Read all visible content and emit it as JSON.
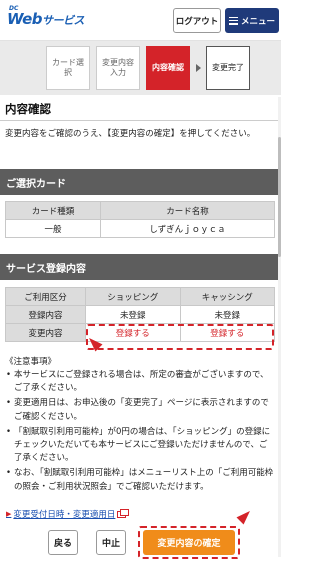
{
  "header": {
    "logo_sub": "DC",
    "logo_main": "Web",
    "logo_suffix": "サービス",
    "logout_label": "ログアウト",
    "menu_label": "メニュー"
  },
  "steps": [
    {
      "label": "カード選択"
    },
    {
      "label": "変更内容入力"
    },
    {
      "label": "内容確認"
    },
    {
      "label": "変更完了"
    }
  ],
  "page": {
    "title": "内容確認",
    "intro": "変更内容をご確認のうえ、【変更内容の確定】を押してください。"
  },
  "card_section": {
    "heading": "ご選択カード",
    "columns": [
      "カード種類",
      "カード名称"
    ],
    "row": [
      "一般",
      "しずぎんｊｏｙｃａ"
    ]
  },
  "service_section": {
    "heading": "サービス登録内容",
    "columns": [
      "ご利用区分",
      "ショッピング",
      "キャッシング"
    ],
    "rows": [
      {
        "label": "登録内容",
        "shopping": "未登録",
        "cashing": "未登録"
      },
      {
        "label": "変更内容",
        "shopping": "登録する",
        "cashing": "登録する"
      }
    ]
  },
  "notes": {
    "title": "《注意事項》",
    "items": [
      "本サービスにご登録される場合は、所定の審査がございますので、ご了承ください。",
      "変更適用日は、お申込後の「変更完了」ページに表示されますのでご確認ください。",
      "「割賦取引利用可能枠」が0円の場合は、「ショッピング」の登録にチェックいただいても本サービスにご登録いただけませんので、ご了承ください。",
      "なお、「割賦取引利用可能枠」はメニューリスト上の「ご利用可能枠の照会・ご利用状況照会」でご確認いただけます。"
    ]
  },
  "history_link": "変更受付日時・変更適用日",
  "buttons": {
    "back": "戻る",
    "cancel": "中止",
    "confirm": "変更内容の確定"
  },
  "colors": {
    "active_step": "#d42329",
    "menu": "#1f3a7a",
    "confirm": "#f08c1a",
    "highlight": "#d42329",
    "section": "#5d5d5d"
  }
}
